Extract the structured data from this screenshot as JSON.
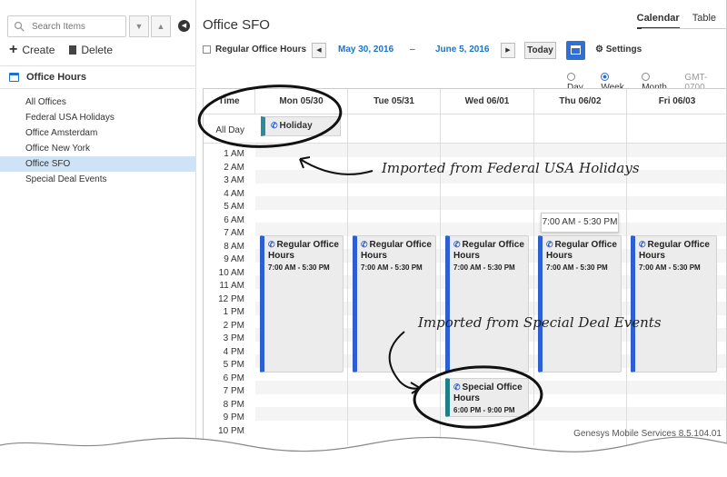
{
  "sidebar": {
    "search_placeholder": "Search Items",
    "create_label": "Create",
    "delete_label": "Delete",
    "section_title": "Office Hours",
    "items": [
      {
        "label": "All Offices",
        "selected": false
      },
      {
        "label": "Federal USA Holidays",
        "selected": false
      },
      {
        "label": "Office Amsterdam",
        "selected": false
      },
      {
        "label": "Office New York",
        "selected": false
      },
      {
        "label": "Office SFO",
        "selected": true
      },
      {
        "label": "Special Deal Events",
        "selected": false
      }
    ]
  },
  "header": {
    "title": "Office SFO",
    "tabs": [
      {
        "label": "Calendar",
        "active": true
      },
      {
        "label": "Table",
        "active": false
      }
    ]
  },
  "toolbar": {
    "filter_label": "Regular Office Hours",
    "start_date": "May 30, 2016",
    "separator": "–",
    "end_date": "June 5, 2016",
    "today_label": "Today",
    "settings_label": "Settings"
  },
  "range": {
    "options": [
      {
        "label": "Day",
        "selected": false
      },
      {
        "label": "Week",
        "selected": true
      },
      {
        "label": "Month",
        "selected": false
      }
    ],
    "timezone": "GMT-0700"
  },
  "grid": {
    "time_header": "Time",
    "all_day_label": "All Day",
    "days": [
      "Mon 05/30",
      "Tue 05/31",
      "Wed 06/01",
      "Thu 06/02",
      "Fri 06/03"
    ],
    "hours": [
      "1 AM",
      "2 AM",
      "3 AM",
      "4 AM",
      "5 AM",
      "6 AM",
      "7 AM",
      "8 AM",
      "9 AM",
      "10 AM",
      "11 AM",
      "12 PM",
      "1 PM",
      "2 PM",
      "3 PM",
      "4 PM",
      "5 PM",
      "6 PM",
      "7 PM",
      "8 PM",
      "9 PM",
      "10 PM"
    ]
  },
  "events": {
    "holiday_label": "Holiday",
    "regular": {
      "name": "Regular Office Hours",
      "time": "7:00 AM - 5:30 PM"
    },
    "special": {
      "name": "Special Office Hours",
      "time": "6:00 PM - 9:00 PM"
    },
    "tooltip": "7:00 AM - 5:30 PM"
  },
  "annotations": {
    "federal": "Imported from Federal USA Holidays",
    "special": "Imported from Special Deal Events"
  },
  "footer": "Genesys Mobile Services 8.5.104.01",
  "colors": {
    "accent": "#2f6fd6",
    "selection": "#cfe3f7",
    "event_bar": "#2d5fd0",
    "special_bar": "#1e7f86"
  }
}
